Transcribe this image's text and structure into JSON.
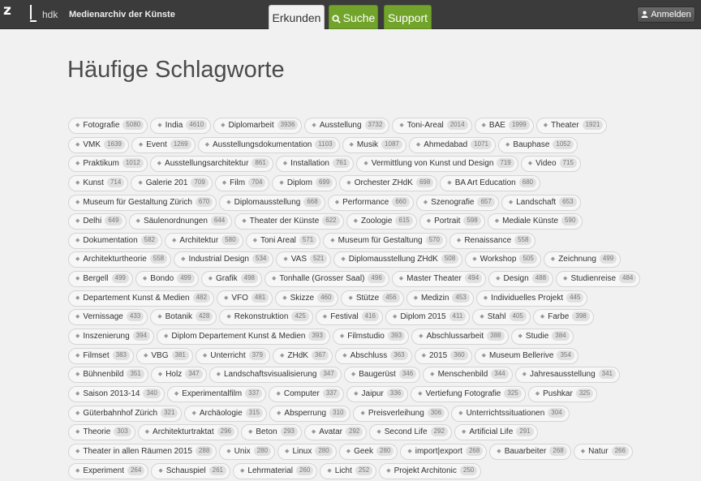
{
  "header": {
    "logo_z": "z",
    "logo_hdk": "hdk",
    "title": "Medienarchiv der Künste",
    "tabs": [
      {
        "label": "Erkunden",
        "active": true
      },
      {
        "label": "Suche",
        "icon": "search-icon"
      },
      {
        "label": "Support"
      }
    ],
    "login_label": "Anmelden",
    "login_icon": "user-icon",
    "accent_color": "#72a42c"
  },
  "main": {
    "title": "Häufige Schlagworte",
    "rows": [
      [
        [
          "Fotografie",
          "5080"
        ],
        [
          "India",
          "4610"
        ],
        [
          "Diplomarbeit",
          "3936"
        ],
        [
          "Ausstellung",
          "3732"
        ],
        [
          "Toni-Areal",
          "2014"
        ],
        [
          "BAE",
          "1999"
        ],
        [
          "Theater",
          "1921"
        ]
      ],
      [
        [
          "VMK",
          "1639"
        ],
        [
          "Event",
          "1269"
        ],
        [
          "Ausstellungsdokumentation",
          "1103"
        ],
        [
          "Musik",
          "1087"
        ],
        [
          "Ahmedabad",
          "1071"
        ],
        [
          "Bauphase",
          "1052"
        ]
      ],
      [
        [
          "Praktikum",
          "1012"
        ],
        [
          "Ausstellungsarchitektur",
          "861"
        ],
        [
          "Installation",
          "761"
        ],
        [
          "Vermittlung von Kunst und Design",
          "719"
        ],
        [
          "Video",
          "715"
        ]
      ],
      [
        [
          "Kunst",
          "714"
        ],
        [
          "Galerie 201",
          "709"
        ],
        [
          "Film",
          "704"
        ],
        [
          "Diplom",
          "699"
        ],
        [
          "Orchester ZHdK",
          "698"
        ],
        [
          "BA Art Education",
          "680"
        ]
      ],
      [
        [
          "Museum für Gestaltung Zürich",
          "670"
        ],
        [
          "Diplomausstellung",
          "668"
        ],
        [
          "Performance",
          "660"
        ],
        [
          "Szenografie",
          "657"
        ],
        [
          "Landschaft",
          "653"
        ]
      ],
      [
        [
          "Delhi",
          "649"
        ],
        [
          "Säulenordnungen",
          "644"
        ],
        [
          "Theater der Künste",
          "622"
        ],
        [
          "Zoologie",
          "615"
        ],
        [
          "Portrait",
          "598"
        ],
        [
          "Mediale Künste",
          "590"
        ]
      ],
      [
        [
          "Dokumentation",
          "582"
        ],
        [
          "Architektur",
          "580"
        ],
        [
          "Toni Areal",
          "571"
        ],
        [
          "Museum für Gestaltung",
          "570"
        ],
        [
          "Renaissance",
          "558"
        ]
      ],
      [
        [
          "Architekturtheorie",
          "558"
        ],
        [
          "Industrial Design",
          "534"
        ],
        [
          "VAS",
          "521"
        ],
        [
          "Diplomausstellung ZHdK",
          "508"
        ],
        [
          "Workshop",
          "505"
        ],
        [
          "Zeichnung",
          "499"
        ]
      ],
      [
        [
          "Bergell",
          "499"
        ],
        [
          "Bondo",
          "499"
        ],
        [
          "Grafik",
          "498"
        ],
        [
          "Tonhalle (Grosser Saal)",
          "496"
        ],
        [
          "Master Theater",
          "494"
        ],
        [
          "Design",
          "488"
        ],
        [
          "Studienreise",
          "484"
        ]
      ],
      [
        [
          "Departement Kunst & Medien",
          "482"
        ],
        [
          "VFO",
          "481"
        ],
        [
          "Skizze",
          "460"
        ],
        [
          "Stütze",
          "456"
        ],
        [
          "Medizin",
          "453"
        ],
        [
          "Individuelles Projekt",
          "445"
        ]
      ],
      [
        [
          "Vernissage",
          "433"
        ],
        [
          "Botanik",
          "428"
        ],
        [
          "Rekonstruktion",
          "425"
        ],
        [
          "Festival",
          "416"
        ],
        [
          "Diplom 2015",
          "411"
        ],
        [
          "Stahl",
          "405"
        ],
        [
          "Farbe",
          "398"
        ]
      ],
      [
        [
          "Inszenierung",
          "394"
        ],
        [
          "Diplom Departement Kunst & Medien",
          "393"
        ],
        [
          "Filmstudio",
          "393"
        ],
        [
          "Abschlussarbeit",
          "388"
        ],
        [
          "Studie",
          "384"
        ]
      ],
      [
        [
          "Filmset",
          "383"
        ],
        [
          "VBG",
          "381"
        ],
        [
          "Unterricht",
          "379"
        ],
        [
          "ZHdK",
          "367"
        ],
        [
          "Abschluss",
          "363"
        ],
        [
          "2015",
          "360"
        ],
        [
          "Museum Bellerive",
          "354"
        ]
      ],
      [
        [
          "Bühnenbild",
          "351"
        ],
        [
          "Holz",
          "347"
        ],
        [
          "Landschaftsvisualisierung",
          "347"
        ],
        [
          "Baugerüst",
          "346"
        ],
        [
          "Menschenbild",
          "344"
        ],
        [
          "Jahresausstellung",
          "341"
        ]
      ],
      [
        [
          "Saison 2013-14",
          "340"
        ],
        [
          "Experimentalfilm",
          "337"
        ],
        [
          "Computer",
          "337"
        ],
        [
          "Jaipur",
          "336"
        ],
        [
          "Vertiefung Fotografie",
          "325"
        ],
        [
          "Pushkar",
          "325"
        ]
      ],
      [
        [
          "Güterbahnhof Zürich",
          "321"
        ],
        [
          "Archäologie",
          "315"
        ],
        [
          "Absperrung",
          "310"
        ],
        [
          "Preisverleihung",
          "306"
        ],
        [
          "Unterrichtssituationen",
          "304"
        ]
      ],
      [
        [
          "Theorie",
          "303"
        ],
        [
          "Architekturtraktat",
          "296"
        ],
        [
          "Beton",
          "293"
        ],
        [
          "Avatar",
          "292"
        ],
        [
          "Second Life",
          "292"
        ],
        [
          "Artificial Life",
          "291"
        ]
      ],
      [
        [
          "Theater in allen Räumen 2015",
          "288"
        ],
        [
          "Unix",
          "280"
        ],
        [
          "Linux",
          "280"
        ],
        [
          "Geek",
          "280"
        ],
        [
          "import|export",
          "268"
        ],
        [
          "Bauarbeiter",
          "268"
        ],
        [
          "Natur",
          "266"
        ]
      ],
      [
        [
          "Experiment",
          "264"
        ],
        [
          "Schauspiel",
          "261"
        ],
        [
          "Lehrmaterial",
          "260"
        ],
        [
          "Licht",
          "252"
        ],
        [
          "Projekt Architonic",
          "250"
        ]
      ]
    ]
  }
}
